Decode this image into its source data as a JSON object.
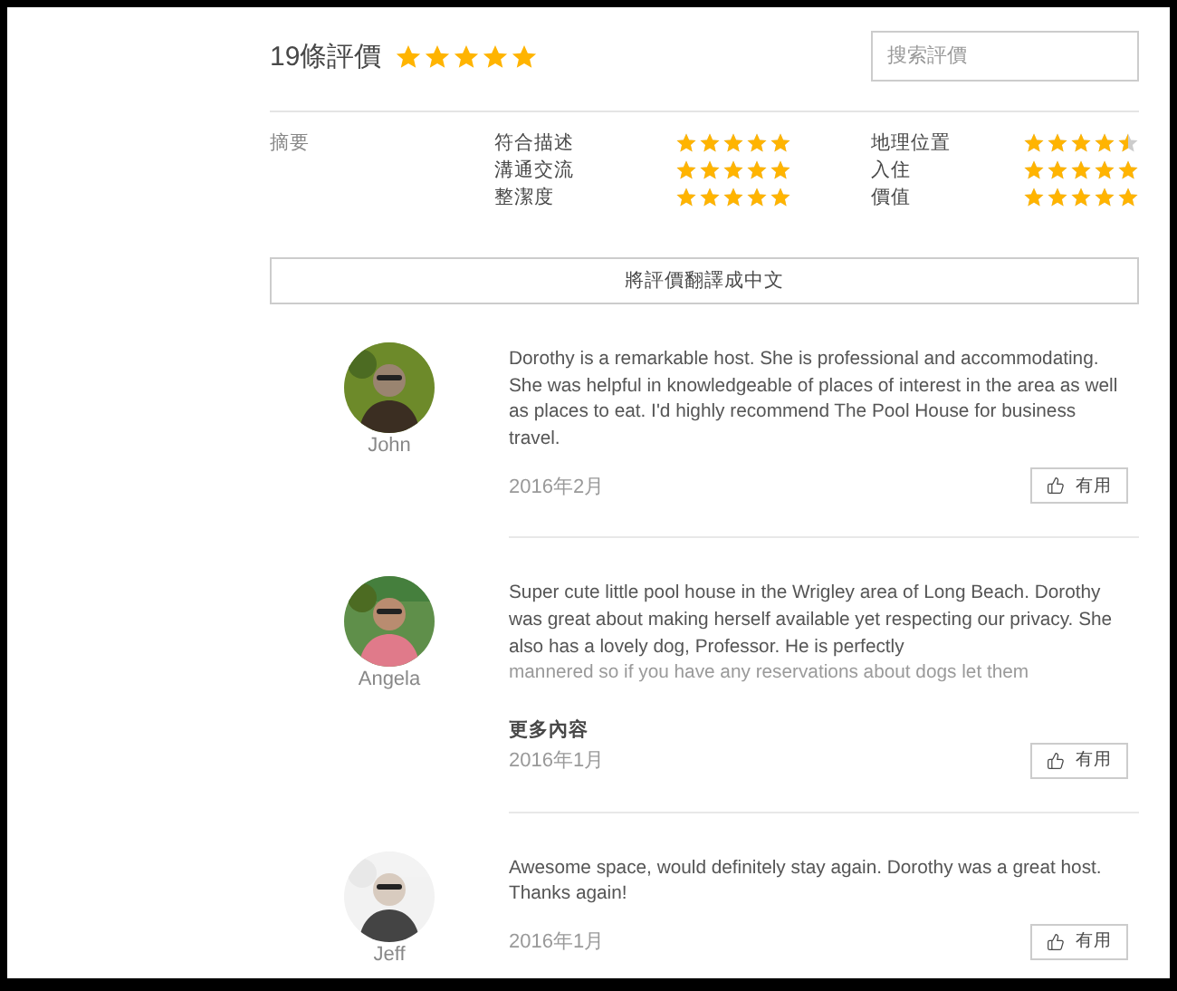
{
  "header": {
    "title": "19條評價",
    "stars": 5,
    "search": {
      "placeholder": "搜索評價"
    }
  },
  "summary": {
    "label": "摘要",
    "categories": [
      {
        "name": "符合描述",
        "stars": 5
      },
      {
        "name": "地理位置",
        "stars": 4.5
      },
      {
        "name": "溝通交流",
        "stars": 5
      },
      {
        "name": "入住",
        "stars": 5
      },
      {
        "name": "整潔度",
        "stars": 5
      },
      {
        "name": "價值",
        "stars": 5
      }
    ]
  },
  "translate_button": "將評價翻譯成中文",
  "reviews": [
    {
      "name": "John",
      "text": "Dorothy is a remarkable host. She is professional and accommodating. She was helpful in knowledgeable of places of interest in the area as well as places to eat. I'd highly recommend The Pool House for business travel.",
      "truncated": false,
      "date": "2016年2月",
      "helpful": "有用"
    },
    {
      "name": "Angela",
      "text": "Super cute little pool house in the Wrigley area of Long Beach. Dorothy was great about making herself available yet respecting our privacy. She also has a lovely dog, Professor. He is perfectly",
      "faded_text": "mannered so if you have any reservations about dogs let them",
      "truncated": true,
      "more": "更多內容",
      "date": "2016年1月",
      "helpful": "有用"
    },
    {
      "name": "Jeff",
      "text": "Awesome space, would definitely stay again. Dorothy was a great host. Thanks again!",
      "truncated": false,
      "date": "2016年1月",
      "helpful": "有用"
    }
  ]
}
